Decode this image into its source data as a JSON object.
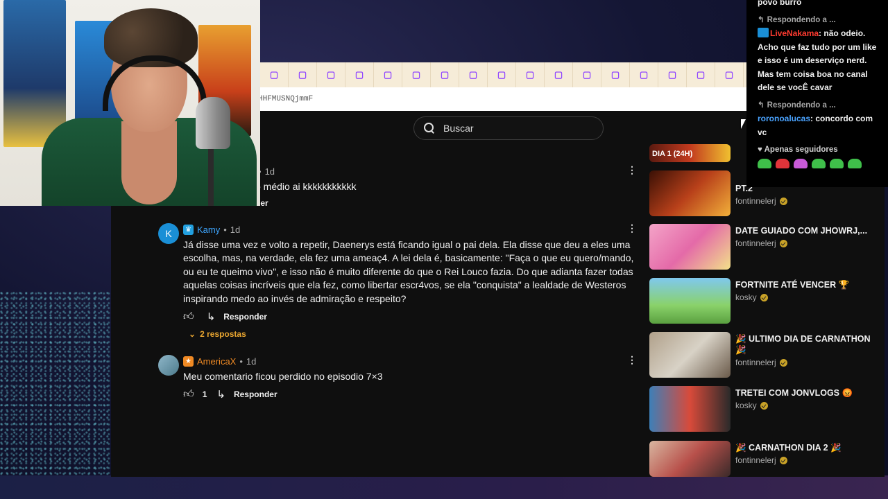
{
  "browser": {
    "tab_glyph": "▢",
    "tab_count": 17,
    "url_fragment": "HHFMUSNQjmmF"
  },
  "search": {
    "placeholder": "Buscar"
  },
  "comments": [
    {
      "author": "",
      "time": "1d",
      "text": "o médio ai kkkkkkkkkkk",
      "reply_label": "der"
    },
    {
      "author": "Kamy",
      "avatar_letter": "K",
      "avatar_color": "#1a8fd6",
      "badge_color": "#22a0e0",
      "author_color": "#3ea6ff",
      "time": "1d",
      "text": "Já disse uma vez e volto a repetir, Daenerys está ficando igual o pai dela. Ela disse que deu a eles uma escolha, mas, na verdade, ela fez uma ameaç4. A lei dela é, basicamente: \"Faça o que eu quero/mando, ou eu te queimo vivo\", e isso não é muito diferente do que o Rei Louco fazia. Do que adianta fazer todas aquelas coisas incríveis que ela fez, como libertar escr4vos, se ela \"conquista\" a lealdade de Westeros inspirando medo ao invés de admiração e respeito?",
      "likes": "",
      "reply_label": "Responder",
      "replies_toggle": "2 respostas"
    },
    {
      "author": "AmericaX",
      "avatar_color": "#6a9ab0",
      "badge_color": "#f08a24",
      "author_color": "#f08a24",
      "time": "1d",
      "text": "Meu comentario ficou perdido no episodio 7×3",
      "likes": "1",
      "reply_label": "Responder"
    }
  ],
  "sidebar": {
    "videos": [
      {
        "title": "",
        "channel": "",
        "thumb_label": "DIA 1 (24H)"
      },
      {
        "title": "PT.2",
        "channel": "fontinnelerj"
      },
      {
        "title": "DATE GUIADO COM JHOWRJ,...",
        "channel": "fontinnelerj"
      },
      {
        "title": "FORTNITE ATÉ VENCER 🏆",
        "channel": "kosky"
      },
      {
        "title": "🎉 ULTIMO DIA DE CARNATHON 🎉",
        "channel": "fontinnelerj"
      },
      {
        "title": "TRETEI COM JONVLOGS 😡",
        "channel": "kosky"
      },
      {
        "title": "🎉 CARNATHON DIA 2 🎉",
        "channel": "fontinnelerj"
      }
    ]
  },
  "chat": {
    "line0": "povo burro",
    "reply_tag_1": "Respondendo a ...",
    "user_1": "LiveNakama",
    "msg_1": ": não odeio. Acho que faz tudo por um like e isso é um deserviço nerd. Mas tem coisa boa no canal dele se vocÊ cavar",
    "reply_tag_2": "Respondendo a ...",
    "user_2": "roronoalucas",
    "msg_2": ": concordo com vc",
    "followers_only": "Apenas seguidores"
  },
  "colors": {
    "twitch_purple": "#9147ff",
    "mention_blue": "#4aa3ff",
    "live_red": "#ff3b30",
    "verified_gold": "#c9a227"
  }
}
